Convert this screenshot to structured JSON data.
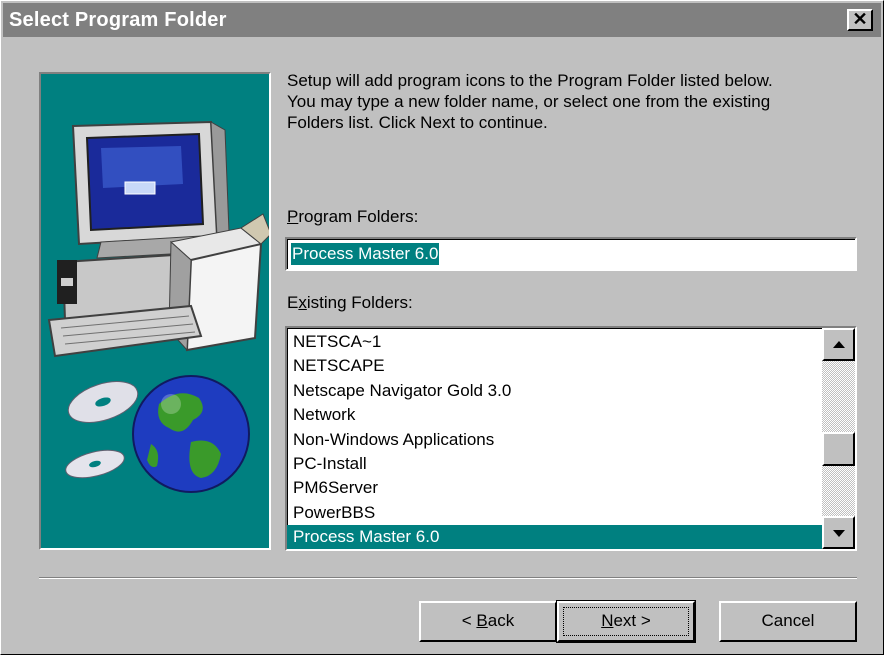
{
  "window": {
    "title": "Select Program Folder",
    "close_glyph": "✕"
  },
  "description": "Setup will add program icons to the Program Folder listed below.\nYou may type a new folder name, or select one from the existing\nFolders list.  Click Next to continue.",
  "program_folders": {
    "label_mnemonic": "P",
    "label_rest": "rogram Folders:",
    "value": "Process Master 6.0"
  },
  "existing_folders": {
    "label_first": "E",
    "label_mnemonic": "x",
    "label_rest": "isting Folders:",
    "items": [
      "NETSCA~1",
      "NETSCAPE",
      "Netscape Navigator Gold 3.0",
      "Network",
      "Non-Windows Applications",
      "PC-Install",
      "PM6Server",
      "PowerBBS",
      "Process Master 6.0"
    ],
    "selected_index": 8
  },
  "buttons": {
    "back_prefix": "< ",
    "back_mnemonic": "B",
    "back_rest": "ack",
    "next_mnemonic": "N",
    "next_rest": "ext >",
    "cancel": "Cancel"
  },
  "colors": {
    "dialog": "#c0c0c0",
    "accent": "#008080",
    "titlebar": "#808080"
  }
}
